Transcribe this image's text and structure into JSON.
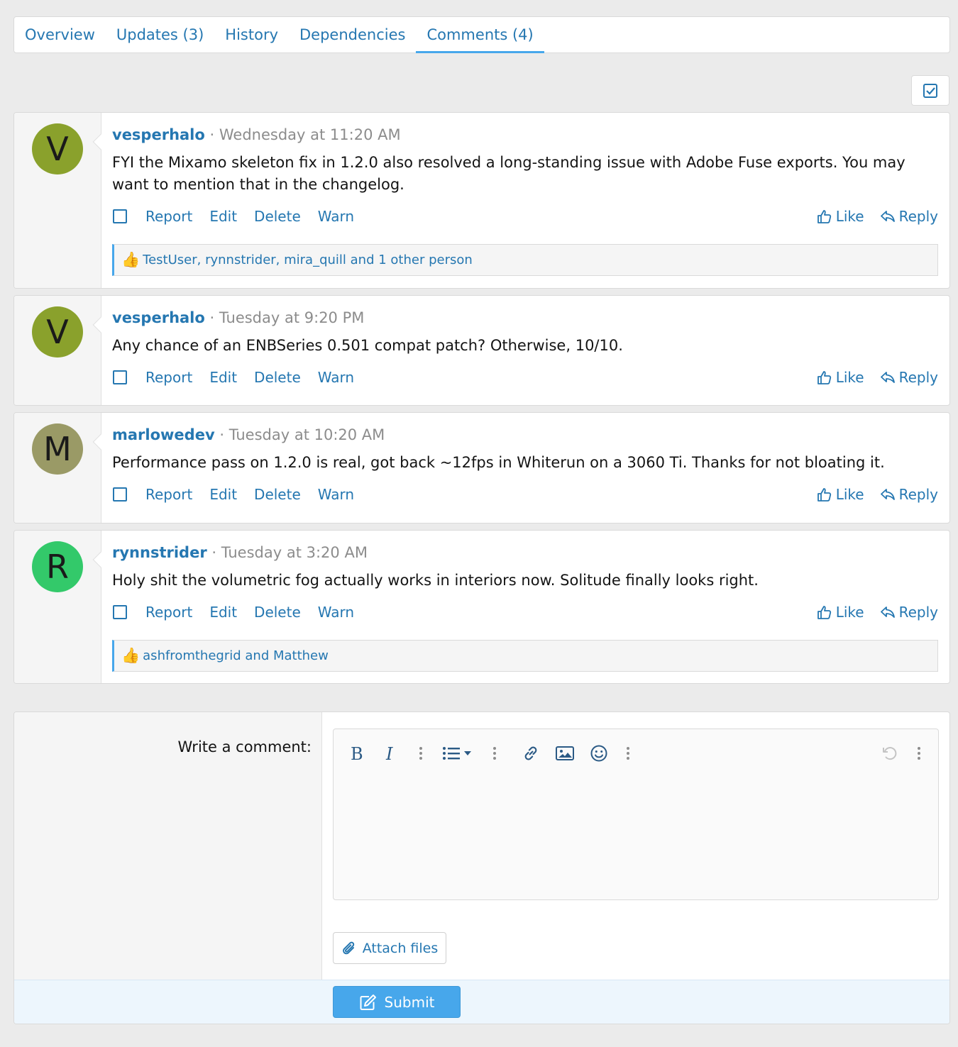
{
  "tabs": [
    {
      "label": "Overview"
    },
    {
      "label": "Updates (3)"
    },
    {
      "label": "History"
    },
    {
      "label": "Dependencies"
    },
    {
      "label": "Comments (4)",
      "active": true
    }
  ],
  "icons": {
    "select_all": "checkbox-checked-icon",
    "like": "thumbs-up-icon",
    "reply": "reply-icon",
    "attach": "paperclip-icon",
    "submit": "edit-icon"
  },
  "comments": [
    {
      "avatar_letter": "V",
      "avatar_color": "#8aa12c",
      "author": "vesperhalo",
      "separator": "·",
      "time": "Wednesday at 11:20 AM",
      "text": "FYI the Mixamo skeleton fix in 1.2.0 also resolved a long-standing issue with Adobe Fuse exports. You may want to mention that in the changelog.",
      "actions": [
        "Report",
        "Edit",
        "Delete",
        "Warn"
      ],
      "like_label": "Like",
      "reply_label": "Reply",
      "likes": "TestUser, rynnstrider, mira_quill and 1 other person"
    },
    {
      "avatar_letter": "V",
      "avatar_color": "#8aa12c",
      "author": "vesperhalo",
      "separator": "·",
      "time": "Tuesday at 9:20 PM",
      "text": "Any chance of an ENBSeries 0.501 compat patch? Otherwise, 10/10.",
      "actions": [
        "Report",
        "Edit",
        "Delete",
        "Warn"
      ],
      "like_label": "Like",
      "reply_label": "Reply"
    },
    {
      "avatar_letter": "M",
      "avatar_color": "#9a9a66",
      "author": "marlowedev",
      "separator": "·",
      "time": "Tuesday at 10:20 AM",
      "text": "Performance pass on 1.2.0 is real, got back ~12fps in Whiterun on a 3060 Ti. Thanks for not bloating it.",
      "actions": [
        "Report",
        "Edit",
        "Delete",
        "Warn"
      ],
      "like_label": "Like",
      "reply_label": "Reply"
    },
    {
      "avatar_letter": "R",
      "avatar_color": "#33c96a",
      "author": "rynnstrider",
      "separator": "·",
      "time": "Tuesday at 3:20 AM",
      "text": "Holy shit the volumetric fog actually works in interiors now. Solitude finally looks right.",
      "actions": [
        "Report",
        "Edit",
        "Delete",
        "Warn"
      ],
      "like_label": "Like",
      "reply_label": "Reply",
      "likes": "ashfromthegrid and Matthew"
    }
  ],
  "reaction_emoji": "👍",
  "form": {
    "label": "Write a comment:",
    "attach_label": "Attach files",
    "submit_label": "Submit"
  }
}
